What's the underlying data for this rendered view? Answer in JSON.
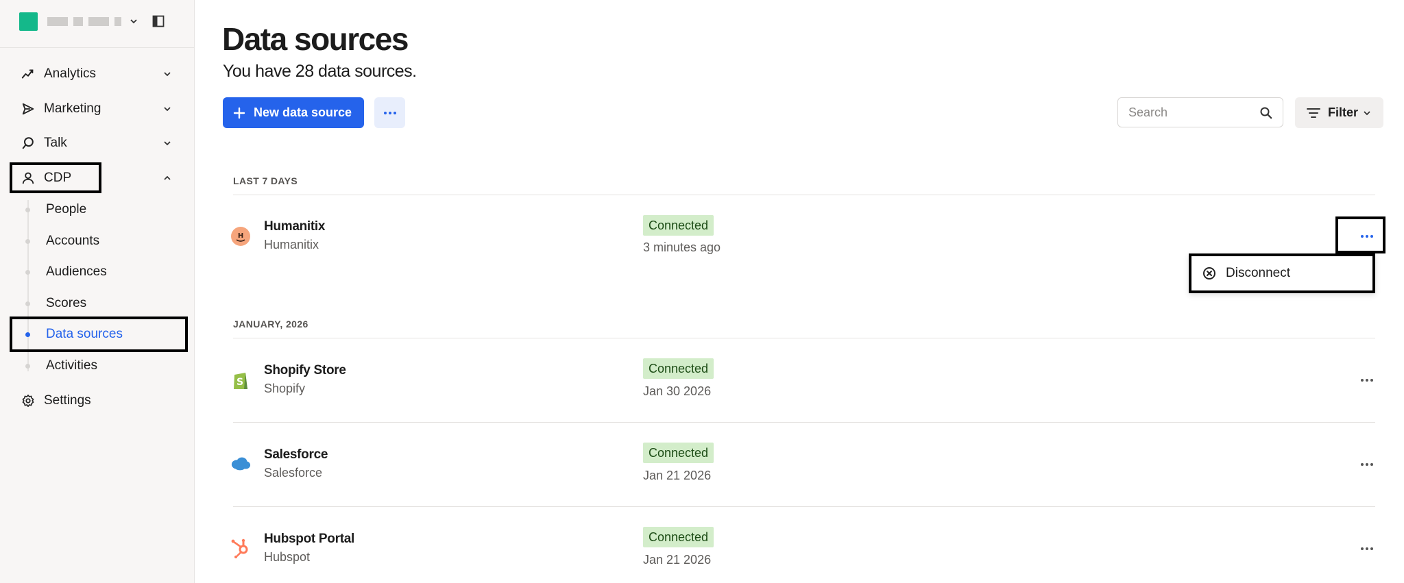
{
  "sidebar": {
    "nav": [
      {
        "label": "Analytics",
        "icon": "analytics-icon"
      },
      {
        "label": "Marketing",
        "icon": "send-icon"
      },
      {
        "label": "Talk",
        "icon": "chat-icon"
      },
      {
        "label": "CDP",
        "icon": "person-icon"
      }
    ],
    "cdp_sub": [
      {
        "label": "People",
        "active": false
      },
      {
        "label": "Accounts",
        "active": false
      },
      {
        "label": "Audiences",
        "active": false
      },
      {
        "label": "Scores",
        "active": false
      },
      {
        "label": "Data sources",
        "active": true
      },
      {
        "label": "Activities",
        "active": false
      }
    ],
    "settings": {
      "label": "Settings",
      "icon": "gear-icon"
    }
  },
  "main": {
    "title": "Data sources",
    "subtitle": "You have 28 data sources.",
    "new_button": "New data source",
    "search_placeholder": "Search",
    "filter_label": "Filter",
    "groups": [
      {
        "label": "LAST 7 DAYS",
        "rows": [
          {
            "name": "Humanitix",
            "type": "Humanitix",
            "status": "Connected",
            "time": "3 minutes ago",
            "logo": "humanitix-logo"
          }
        ]
      },
      {
        "label": "JANUARY, 2026",
        "rows": [
          {
            "name": "Shopify Store",
            "type": "Shopify",
            "status": "Connected",
            "time": "Jan 30 2026",
            "logo": "shopify-logo"
          },
          {
            "name": "Salesforce",
            "type": "Salesforce",
            "status": "Connected",
            "time": "Jan 21 2026",
            "logo": "salesforce-logo"
          },
          {
            "name": "Hubspot Portal",
            "type": "Hubspot",
            "status": "Connected",
            "time": "Jan 21 2026",
            "logo": "hubspot-logo"
          }
        ]
      }
    ],
    "row_menu": {
      "disconnect_label": "Disconnect"
    }
  },
  "colors": {
    "accent": "#2563eb",
    "brand": "#14b88a",
    "badge_bg": "#d3edca",
    "badge_text": "#1d4d16"
  }
}
